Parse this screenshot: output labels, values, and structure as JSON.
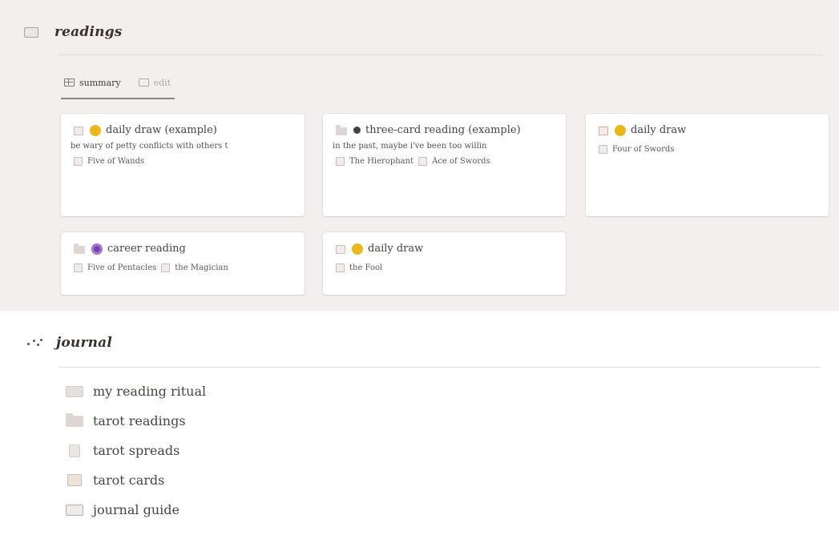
{
  "readings": {
    "title": "readings",
    "tabs": [
      {
        "label": "summary",
        "active": true
      },
      {
        "label": "edit",
        "active": false
      }
    ],
    "cards": [
      {
        "title": "daily draw (example)",
        "emoji": "sun-emoji-icon",
        "description": "be wary of petty conflicts with others t",
        "tags": [
          "Five of Wands"
        ]
      },
      {
        "title": "three-card reading (example)",
        "emoji": "moon-emoji-icon",
        "description": "in the past, maybe i've been too willin",
        "tags": [
          "The Hierophant",
          "Ace of Swords"
        ]
      },
      {
        "title": "daily draw",
        "emoji": "sun-emoji-icon",
        "description": "",
        "tags": [
          "Four of Swords"
        ]
      },
      {
        "title": "career reading",
        "emoji": "crystal-ball-icon",
        "description": "",
        "tags": [
          "Five of Pentacles",
          "the Magician"
        ]
      },
      {
        "title": "daily draw",
        "emoji": "sun-emoji-icon",
        "description": "",
        "tags": [
          "the Fool"
        ]
      }
    ]
  },
  "journal": {
    "title": "journal",
    "items": [
      {
        "label": "my reading ritual",
        "icon": "ritual-icon"
      },
      {
        "label": "tarot readings",
        "icon": "folder-icon"
      },
      {
        "label": "tarot spreads",
        "icon": "spread-icon"
      },
      {
        "label": "tarot cards",
        "icon": "cards-icon"
      },
      {
        "label": "journal guide",
        "icon": "book-icon"
      }
    ]
  },
  "colors": {
    "panel_background": "#f3efee",
    "accent_sun": "#e8b81c",
    "accent_purple": "#7b3fb0"
  }
}
